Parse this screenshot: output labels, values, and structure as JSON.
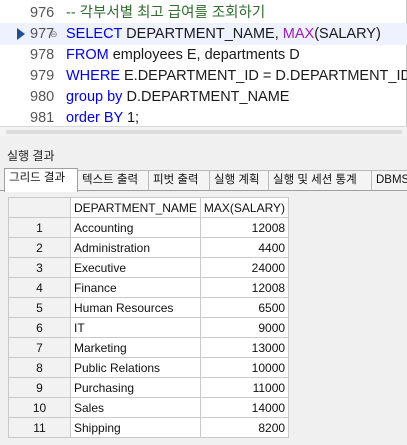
{
  "editor": {
    "lines": [
      {
        "num": "976",
        "tokens": [
          {
            "t": "-- 각부서별 최고 급여를 조회하기",
            "c": "cm"
          }
        ]
      },
      {
        "num": "977",
        "current": true,
        "fold": true,
        "tokens": [
          {
            "t": "SELECT",
            "c": "kw"
          },
          {
            "t": " DEPARTMENT_NAME, ",
            "c": ""
          },
          {
            "t": "MAX",
            "c": "fn"
          },
          {
            "t": "(SALARY)",
            "c": ""
          }
        ]
      },
      {
        "num": "978",
        "tokens": [
          {
            "t": "FROM",
            "c": "kw"
          },
          {
            "t": " employees E, departments D",
            "c": ""
          }
        ]
      },
      {
        "num": "979",
        "tokens": [
          {
            "t": "WHERE",
            "c": "kw"
          },
          {
            "t": " E.DEPARTMENT_ID = D.DEPARTMENT_ID",
            "c": ""
          }
        ]
      },
      {
        "num": "980",
        "tokens": [
          {
            "t": "group by",
            "c": "kw"
          },
          {
            "t": " D.DEPARTMENT_NAME",
            "c": ""
          }
        ]
      },
      {
        "num": "981",
        "tokens": [
          {
            "t": "order BY",
            "c": "kw"
          },
          {
            "t": " 1;",
            "c": ""
          }
        ]
      }
    ]
  },
  "results": {
    "panel_title": "실행 결과",
    "tabs": [
      "그리드 결과",
      "텍스트 출력",
      "피벗 출력",
      "실행 계획",
      "실행 및 세션 통계",
      "DBMS"
    ],
    "active_tab": 0,
    "columns": [
      "DEPARTMENT_NAME",
      "MAX(SALARY)"
    ],
    "rows": [
      {
        "n": "1",
        "dept": "Accounting",
        "max": "12008"
      },
      {
        "n": "2",
        "dept": "Administration",
        "max": "4400"
      },
      {
        "n": "3",
        "dept": "Executive",
        "max": "24000"
      },
      {
        "n": "4",
        "dept": "Finance",
        "max": "12008"
      },
      {
        "n": "5",
        "dept": "Human Resources",
        "max": "6500"
      },
      {
        "n": "6",
        "dept": "IT",
        "max": "9000"
      },
      {
        "n": "7",
        "dept": "Marketing",
        "max": "13000"
      },
      {
        "n": "8",
        "dept": "Public Relations",
        "max": "10000"
      },
      {
        "n": "9",
        "dept": "Purchasing",
        "max": "11000"
      },
      {
        "n": "10",
        "dept": "Sales",
        "max": "14000"
      },
      {
        "n": "11",
        "dept": "Shipping",
        "max": "8200"
      }
    ]
  }
}
